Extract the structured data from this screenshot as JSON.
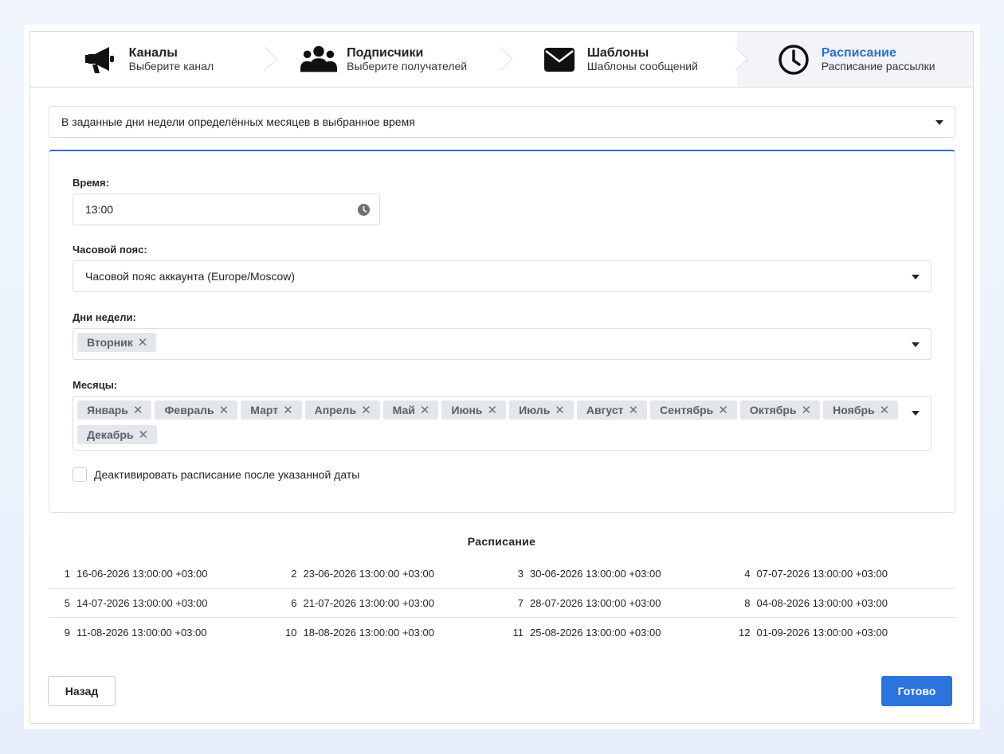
{
  "steps": [
    {
      "title": "Каналы",
      "subtitle": "Выберите канал",
      "icon": "megaphone-icon"
    },
    {
      "title": "Подписчики",
      "subtitle": "Выберите получателей",
      "icon": "users-icon"
    },
    {
      "title": "Шаблоны",
      "subtitle": "Шаблоны сообщений",
      "icon": "envelope-icon"
    },
    {
      "title": "Расписание",
      "subtitle": "Расписание рассылки",
      "icon": "clock-icon"
    }
  ],
  "active_step": 3,
  "schedule_type": {
    "value": "В заданные дни недели определённых месяцев в выбранное время"
  },
  "time": {
    "label": "Время:",
    "value": "13:00"
  },
  "timezone": {
    "label": "Часовой пояс:",
    "value": "Часовой пояс аккаунта (Europe/Moscow)"
  },
  "weekdays": {
    "label": "Дни недели:",
    "tags": [
      "Вторник"
    ]
  },
  "months": {
    "label": "Месяцы:",
    "tags": [
      "Январь",
      "Февраль",
      "Март",
      "Апрель",
      "Май",
      "Июнь",
      "Июль",
      "Август",
      "Сентябрь",
      "Октябрь",
      "Ноябрь",
      "Декабрь"
    ]
  },
  "deactivate": {
    "label": "Деактивировать расписание после указанной даты",
    "checked": false
  },
  "schedule": {
    "title": "Расписание",
    "rows": [
      [
        {
          "n": "1",
          "v": "16-06-2026 13:00:00 +03:00"
        },
        {
          "n": "2",
          "v": "23-06-2026 13:00:00 +03:00"
        },
        {
          "n": "3",
          "v": "30-06-2026 13:00:00 +03:00"
        },
        {
          "n": "4",
          "v": "07-07-2026 13:00:00 +03:00"
        }
      ],
      [
        {
          "n": "5",
          "v": "14-07-2026 13:00:00 +03:00"
        },
        {
          "n": "6",
          "v": "21-07-2026 13:00:00 +03:00"
        },
        {
          "n": "7",
          "v": "28-07-2026 13:00:00 +03:00"
        },
        {
          "n": "8",
          "v": "04-08-2026 13:00:00 +03:00"
        }
      ],
      [
        {
          "n": "9",
          "v": "11-08-2026 13:00:00 +03:00"
        },
        {
          "n": "10",
          "v": "18-08-2026 13:00:00 +03:00"
        },
        {
          "n": "11",
          "v": "25-08-2026 13:00:00 +03:00"
        },
        {
          "n": "12",
          "v": "01-09-2026 13:00:00 +03:00"
        }
      ]
    ]
  },
  "buttons": {
    "back": "Назад",
    "done": "Готово"
  },
  "colors": {
    "accent": "#2a6fd6",
    "button_primary": "#2b73dd",
    "tag_bg": "#e3e6ea"
  }
}
